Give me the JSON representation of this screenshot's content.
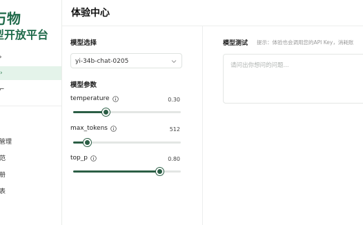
{
  "brand": {
    "line1": "万物",
    "line2": "型开放平台"
  },
  "sidebar": {
    "items": [
      {
        "label": "›",
        "active": false
      },
      {
        "label": "›",
        "active": true
      },
      {
        "label": "⌐",
        "active": false
      },
      {
        "label": "管理",
        "active": false
      },
      {
        "label": "范",
        "active": false
      },
      {
        "label": "册",
        "active": false
      },
      {
        "label": "表",
        "active": false
      }
    ]
  },
  "header": {
    "title": "体验中心"
  },
  "settings": {
    "model_select_title": "模型选择",
    "model_selected": "yi-34b-chat-0205",
    "params_title": "模型参数",
    "params": [
      {
        "name": "temperature",
        "value": "0.30",
        "fraction": 0.3
      },
      {
        "name": "max_tokens",
        "value": "512",
        "fraction": 0.125
      },
      {
        "name": "top_p",
        "value": "0.80",
        "fraction": 0.8
      }
    ]
  },
  "test": {
    "title": "模型测试",
    "hint": "提示：体验也会调用您的API Key，消耗账",
    "input_placeholder": "请问出你想问的问题..."
  },
  "colors": {
    "accent": "#2b5e45",
    "brand": "#1f6a4a",
    "active_nav_bg": "#e4f3ea"
  }
}
